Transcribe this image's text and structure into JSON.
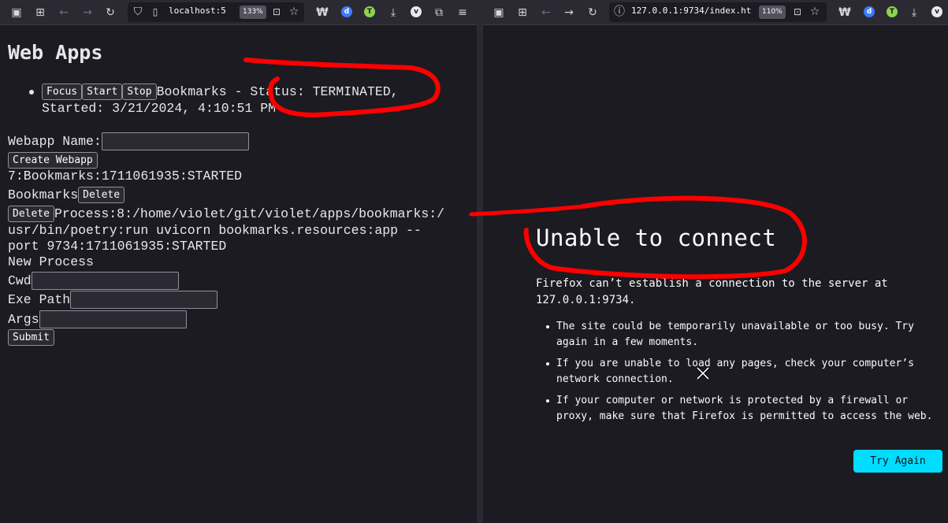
{
  "left_browser": {
    "url": "localhost:5",
    "zoom": "133%",
    "icons": [
      "sidebar-icon",
      "tab-view-icon",
      "back-icon",
      "forward-icon",
      "reload-icon",
      "tracking-shield-icon",
      "page-icon",
      "reader-icon",
      "bookmark-star-icon",
      "extension-w-icon",
      "extension-blue-icon",
      "extension-green-icon",
      "download-icon",
      "extension-v-icon",
      "extensions-puzzle-icon",
      "menu-icon"
    ]
  },
  "right_browser": {
    "url": "127.0.0.1:9734/index.ht",
    "zoom": "110%"
  },
  "webapps": {
    "title": "Web Apps",
    "app": {
      "focus_label": "Focus",
      "start_label": "Start",
      "stop_label": "Stop",
      "line1": "Bookmarks - Status: TERMINATED,",
      "line2": "Started: 3/21/2024, 4:10:51 PM"
    },
    "webapp_name_label": "Webapp Name:",
    "webapp_name_value": "",
    "create_label": "Create Webapp",
    "record_line": "7:Bookmarks:1711061935:STARTED",
    "bookmarks_label": "Bookmarks",
    "delete_label": "Delete",
    "process_delete_label": "Delete",
    "process_line1": "Process:8:/home/violet/git/violet/apps/bookmarks:/",
    "process_line2": "usr/bin/poetry:run uvicorn bookmarks.resources:app --",
    "process_line3": "port 9734:1711061935:STARTED",
    "new_process_label": "New Process",
    "cwd_label": "Cwd",
    "exe_path_label": "Exe Path",
    "args_label": "Args",
    "submit_label": "Submit"
  },
  "error_page": {
    "title": "Unable to connect",
    "description_line1": "Firefox can’t establish a connection to the server at",
    "description_line2": "127.0.0.1:9734.",
    "bullets": [
      "The site could be temporarily unavailable or too busy. Try again in a few moments.",
      "If you are unable to load any pages, check your computer’s network connection.",
      "If your computer or network is protected by a firewall or proxy, make sure that Firefox is permitted to access the web."
    ],
    "try_again_label": "Try Again"
  },
  "colors": {
    "page_bg": "#1c1b22",
    "toolbar_bg": "#2b2a33",
    "accent": "#00ddff",
    "annotation": "#ff0000"
  }
}
